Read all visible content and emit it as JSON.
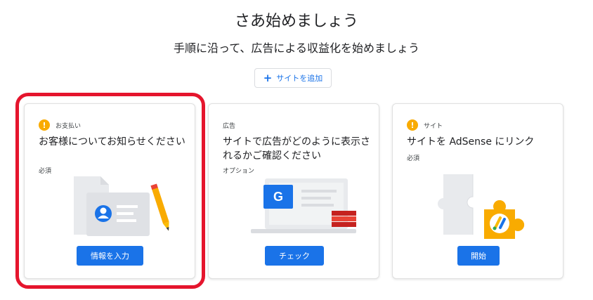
{
  "header": {
    "title": "さあ始めましょう",
    "subtitle": "手順に沿って、広告による収益化を始めましょう",
    "add_site_label": "サイトを追加"
  },
  "cards": [
    {
      "category": "お支払い",
      "title": "お客様についてお知らせください",
      "status": "必須",
      "button": "情報を入力",
      "icon": "warning-icon"
    },
    {
      "category": "広告",
      "title": "サイトで広告がどのように表示されるかご確認ください",
      "status": "オプション",
      "button": "チェック"
    },
    {
      "category": "サイト",
      "title": "サイトを AdSense にリンク",
      "status": "必須",
      "button": "開始",
      "icon": "warning-icon"
    }
  ],
  "illustration_texts": {
    "google_g": "G"
  },
  "colors": {
    "primary": "#1a73e8",
    "warning": "#f9ab00",
    "highlight": "#e5152d"
  }
}
